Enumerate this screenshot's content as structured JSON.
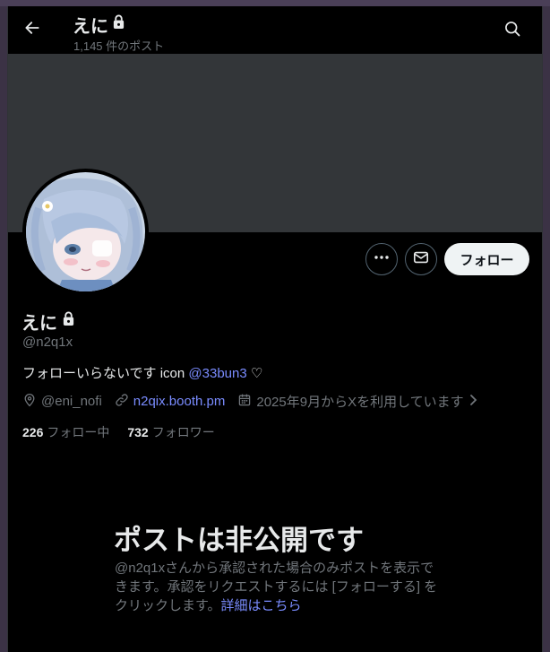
{
  "header": {
    "title": "えに",
    "post_count": "1,145 件のポスト"
  },
  "profile": {
    "name": "えに",
    "handle": "@n2q1x",
    "bio_text": "フォローいらないです icon",
    "bio_mention": "@33bun3",
    "bio_heart": "♡",
    "location": "@eni_nofi",
    "website": "n2qix.booth.pm",
    "joined": "2025年9月からXを利用しています",
    "following_count": "226",
    "following_label": "フォロー中",
    "followers_count": "732",
    "followers_label": "フォロワー"
  },
  "actions": {
    "follow_label": "フォロー"
  },
  "private": {
    "title": "ポストは非公開です",
    "body": "@n2q1xさんから承認された場合のみポストを表示できます。承認をリクエストするには [フォローする] をクリックします。",
    "link": "詳細はこちら"
  },
  "colors": {
    "background": "#000000",
    "banner": "#333639",
    "accent_link": "#7a8cff",
    "muted_text": "#71767b",
    "primary_text": "#e7e9ea",
    "follow_button_bg": "#eff3f4"
  }
}
